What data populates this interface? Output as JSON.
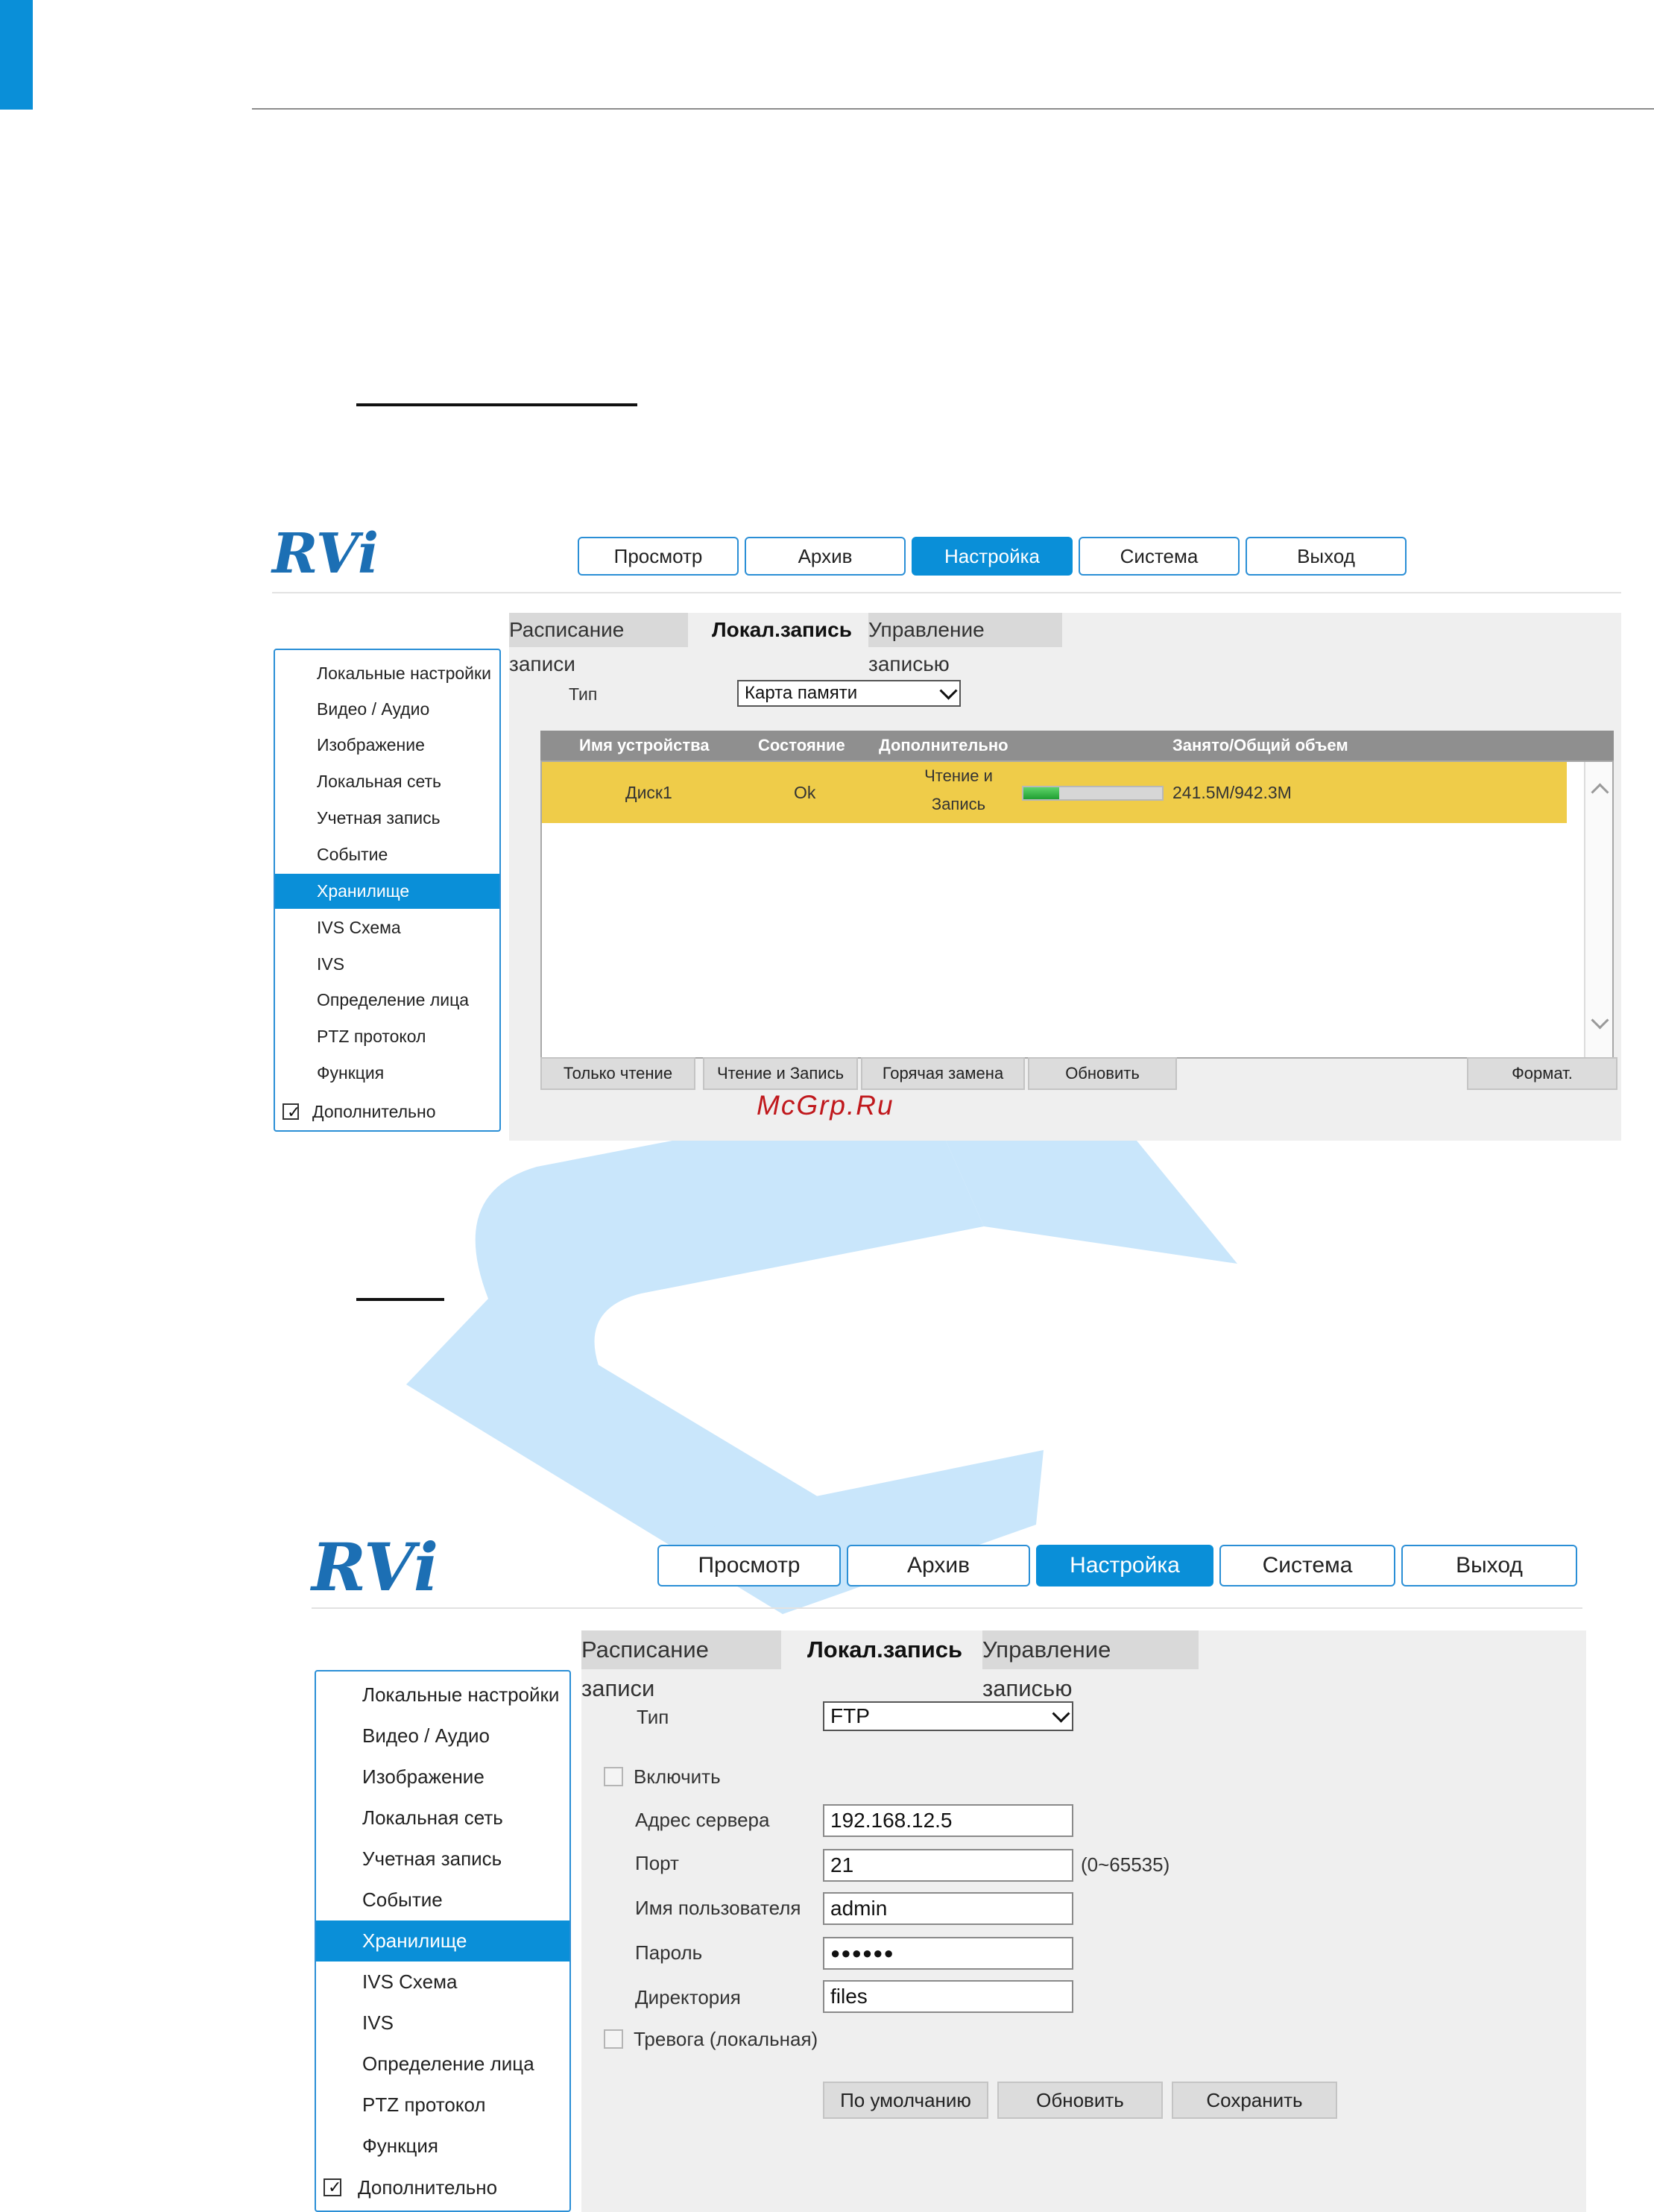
{
  "watermark": {
    "site_label": "McGrp.Ru",
    "color": "#c9e6fb"
  },
  "colors": {
    "accent": "#0a8fd8",
    "row_highlight": "#efcc49",
    "table_header": "#8f8f8f"
  },
  "screen1": {
    "logo": "RVi",
    "nav": [
      "Просмотр",
      "Архив",
      "Настройка",
      "Система",
      "Выход"
    ],
    "nav_active": "Настройка",
    "tabs": [
      "Расписание записи",
      "Локал.запись",
      "Управление записью"
    ],
    "tab_active": "Локал.запись",
    "sidebar": {
      "items": [
        "Локальные настройки",
        "Видео / Аудио",
        "Изображение",
        "Локальная сеть",
        "Учетная запись",
        "Событие",
        "Хранилище",
        "IVS Схема",
        "IVS",
        "Определение лица",
        "PTZ протокол",
        "Функция"
      ],
      "active": "Хранилище",
      "advanced_label": "Дополнительно",
      "advanced_checked": true
    },
    "type_label": "Тип",
    "type_value": "Карта памяти",
    "table": {
      "headers": [
        "Имя устройства",
        "Состояние",
        "Дополнительно",
        "Занято/Общий объем"
      ],
      "rows": [
        {
          "device": "Диск1",
          "status": "Ok",
          "extra_line1": "Чтение и",
          "extra_line2": "Запись",
          "usage": "241.5M/942.3M",
          "used_fraction": 0.256
        }
      ]
    },
    "buttons": {
      "read_only": "Только чтение",
      "read_write": "Чтение и Запись",
      "hot_swap": "Горячая замена",
      "refresh": "Обновить",
      "format": "Формат."
    }
  },
  "screen2": {
    "logo": "RVi",
    "nav": [
      "Просмотр",
      "Архив",
      "Настройка",
      "Система",
      "Выход"
    ],
    "nav_active": "Настройка",
    "tabs": [
      "Расписание записи",
      "Локал.запись",
      "Управление записью"
    ],
    "tab_active": "Локал.запись",
    "sidebar": {
      "items": [
        "Локальные настройки",
        "Видео / Аудио",
        "Изображение",
        "Локальная сеть",
        "Учетная запись",
        "Событие",
        "Хранилище",
        "IVS Схема",
        "IVS",
        "Определение лица",
        "PTZ протокол",
        "Функция"
      ],
      "active": "Хранилище",
      "advanced_label": "Дополнительно",
      "advanced_checked": true
    },
    "type_label": "Тип",
    "type_value": "FTP",
    "enable_label": "Включить",
    "enable_checked": false,
    "fields": {
      "server_label": "Адрес сервера",
      "server_value": "192.168.12.5",
      "port_label": "Порт",
      "port_value": "21",
      "port_hint": "(0~65535)",
      "user_label": "Имя пользователя",
      "user_value": "admin",
      "password_label": "Пароль",
      "password_value": "●●●●●●",
      "dir_label": "Директория",
      "dir_value": "files"
    },
    "alarm_label": "Тревога (локальная)",
    "alarm_checked": false,
    "buttons": {
      "default": "По умолчанию",
      "refresh": "Обновить",
      "save": "Сохранить"
    }
  }
}
